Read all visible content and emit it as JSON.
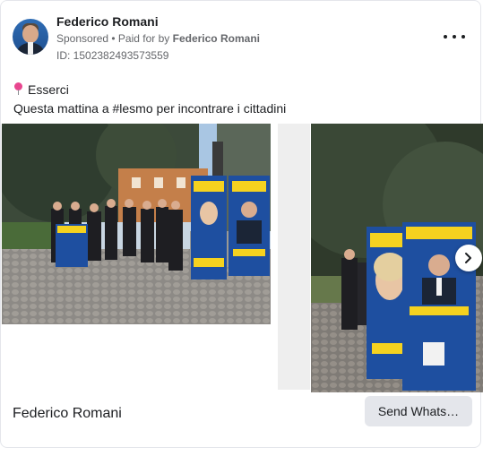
{
  "ad": {
    "advertiser_name": "Federico Romani",
    "sponsored_label": "Sponsored",
    "separator": " • ",
    "paid_for_prefix": "Paid for by ",
    "paid_for_name": "Federico Romani",
    "ad_id": "ID: 1502382493573559",
    "more_icon": "more-horizontal-icon"
  },
  "body": {
    "line1_icon": "pushpin-icon",
    "line1": "Esserci",
    "line2": "Questa mattina a #lesmo per incontrare i cittadini"
  },
  "carousel": {
    "next_icon": "chevron-right-icon",
    "banner_left": {
      "title": "ESSERCI",
      "name": "ROMANI",
      "phone": "338 8979462"
    },
    "banner_right": {
      "title": "ESSERCI",
      "subtitle": "IERI. OGGI. DOMANI.",
      "name": "ROMANI",
      "phone": "338 8979462"
    }
  },
  "footer": {
    "page_name": "Federico Romani",
    "cta_label": "Send Whats…"
  },
  "colors": {
    "banner_blue": "#1e4fa0",
    "banner_yellow": "#f5d21f",
    "cta_bg": "#e4e6eb",
    "secondary_text": "#65676b"
  }
}
